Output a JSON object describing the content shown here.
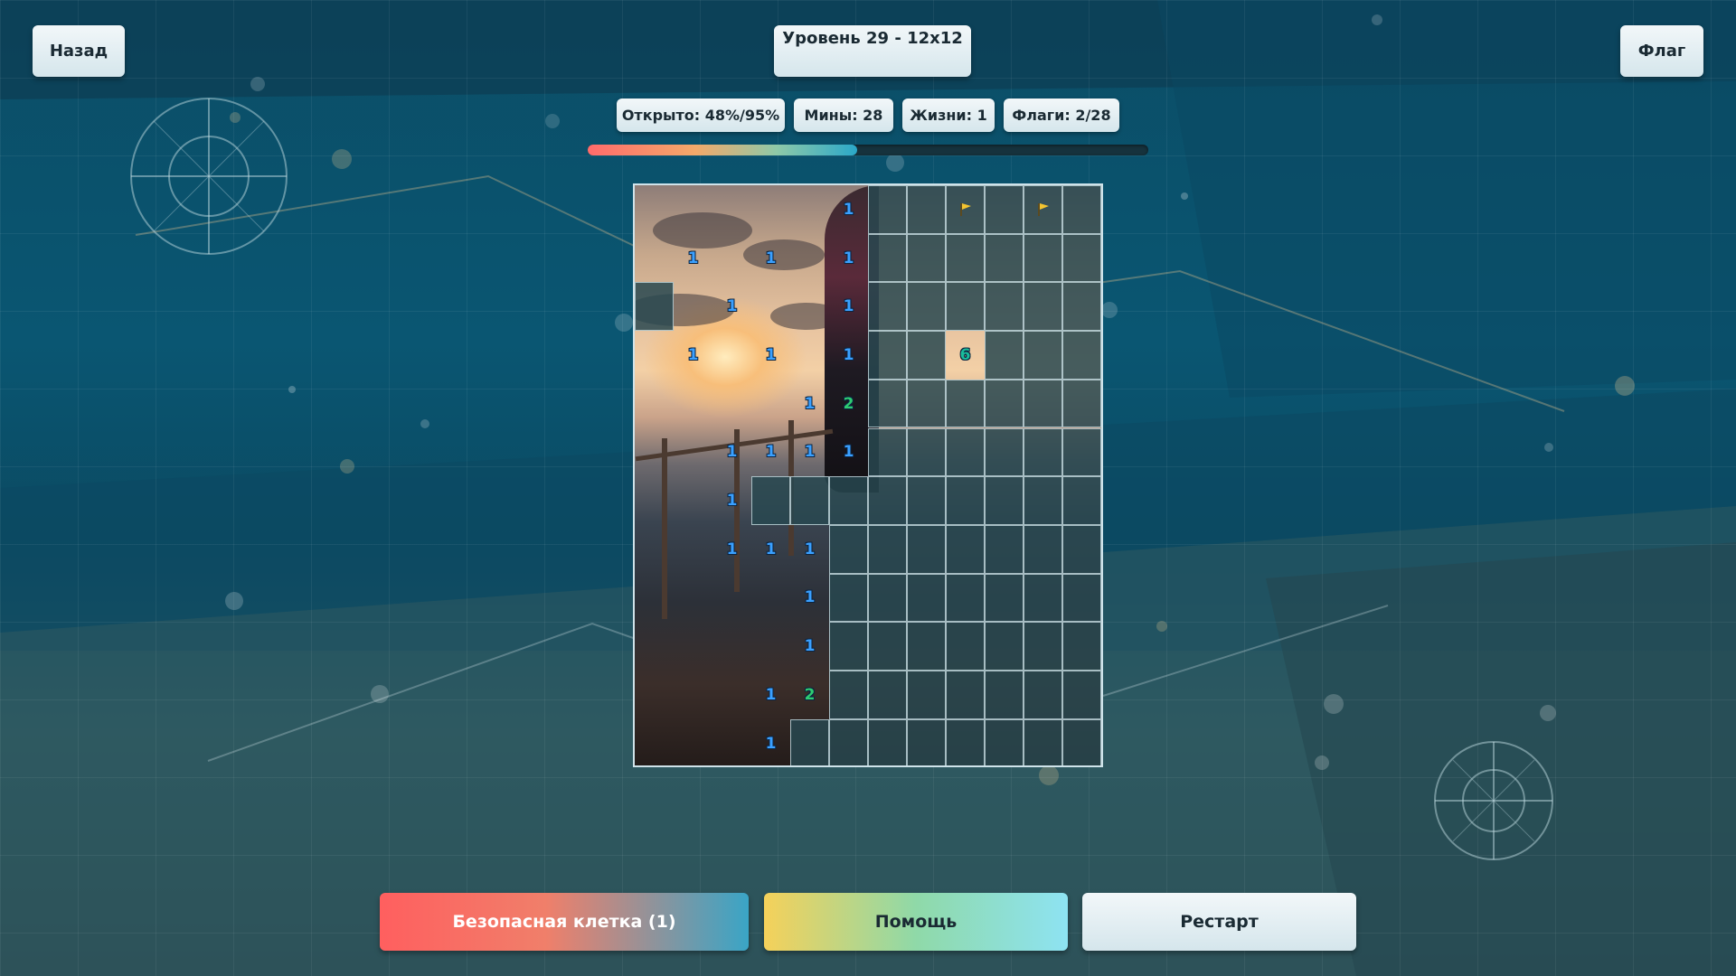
{
  "header": {
    "back_label": "Назад",
    "level_title": "Уровень 29 - 12x12",
    "flag_label": "Флаг"
  },
  "stats": {
    "opened": "Открыто: 48%/95%",
    "mines": "Мины: 28",
    "lives": "Жизни: 1",
    "flags": "Флаги: 2/28"
  },
  "progress": {
    "fraction": 0.48
  },
  "board": {
    "cols": 12,
    "rows": 12,
    "cells": [
      [
        "o",
        "o",
        "o",
        "o",
        "o",
        "1",
        "h",
        "h",
        "F",
        "h",
        "F",
        "h"
      ],
      [
        "o",
        "1",
        "o",
        "1",
        "o",
        "1",
        "h",
        "h",
        "h",
        "h",
        "h",
        "h"
      ],
      [
        "h",
        "o",
        "1",
        "o",
        "o",
        "1",
        "h",
        "h",
        "h",
        "h",
        "h",
        "h"
      ],
      [
        "o",
        "1",
        "o",
        "1",
        "o",
        "1",
        "h",
        "h",
        "6",
        "h",
        "h",
        "h"
      ],
      [
        "o",
        "o",
        "o",
        "o",
        "1",
        "2",
        "h",
        "h",
        "h",
        "h",
        "h",
        "h"
      ],
      [
        "o",
        "o",
        "1",
        "1",
        "1",
        "1",
        "h",
        "h",
        "h",
        "h",
        "h",
        "h"
      ],
      [
        "o",
        "o",
        "1",
        "h",
        "h",
        "h",
        "h",
        "h",
        "h",
        "h",
        "h",
        "h"
      ],
      [
        "o",
        "o",
        "1",
        "1",
        "1",
        "h",
        "h",
        "h",
        "h",
        "h",
        "h",
        "h"
      ],
      [
        "o",
        "o",
        "o",
        "o",
        "1",
        "h",
        "h",
        "h",
        "h",
        "h",
        "h",
        "h"
      ],
      [
        "o",
        "o",
        "o",
        "o",
        "1",
        "h",
        "h",
        "h",
        "h",
        "h",
        "h",
        "h"
      ],
      [
        "o",
        "o",
        "o",
        "1",
        "2",
        "h",
        "h",
        "h",
        "h",
        "h",
        "h",
        "h"
      ],
      [
        "o",
        "o",
        "o",
        "1",
        "h",
        "h",
        "h",
        "h",
        "h",
        "h",
        "h",
        "h"
      ]
    ]
  },
  "footer": {
    "safe_cell_label": "Безопасная клетка (1)",
    "help_label": "Помощь",
    "restart_label": "Рестарт"
  },
  "colors": {
    "accent_red": "#ff6b6b",
    "accent_teal": "#2aa8c9",
    "number_one": "#3aa0ff",
    "number_two": "#2ecc71",
    "flag": "#f4c430"
  }
}
